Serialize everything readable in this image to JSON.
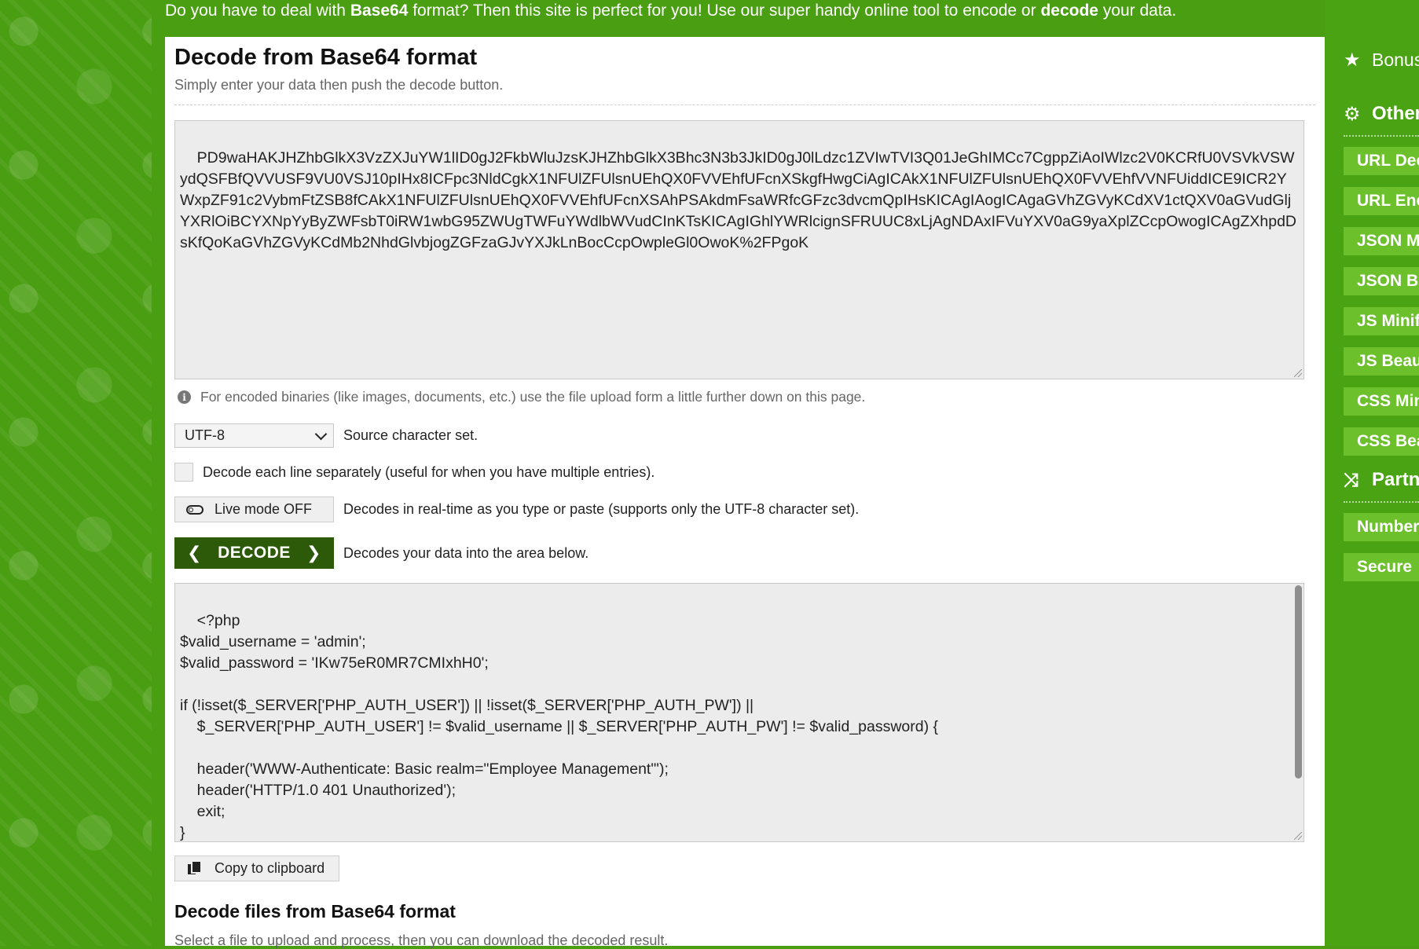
{
  "banner": {
    "part1": "Do you have to deal with ",
    "bold1": "Base64",
    "part2": " format? Then this site is perfect for you! Use our super handy online tool to encode or ",
    "bold2": "decode",
    "part3": " your data."
  },
  "main": {
    "title": "Decode from Base64 format",
    "subtitle": "Simply enter your data then push the decode button.",
    "input_value": "PD9waHAKJHZhbGlkX3VzZXJuYW1lID0gJ2FkbWluJzsKJHZhbGlkX3Bhc3N3b3JkID0gJ0lLdzc1ZVIwTVI3Q01JeGhIMCc7CgppZiAoIWlzc2V0KCRfU0VSVkVSWydQSFBfQVVUSF9VU0VSJ10pIHx8ICFpc3NldCgkX1NFUlZFUlsnUEhQX0FVVEhfUFcnXSkgfHwgCiAgICAkX1NFUlZFUlsnUEhQX0FVVEhfVVNFUiddICE9ICR2YWxpZF91c2VybmFtZSB8fCAkX1NFUlZFUlsnUEhQX0FVVEhfUFcnXSAhPSAkdmFsaWRfcGFzc3dvcmQpIHsKICAgIAogICAgaGVhZGVyKCdXV1ctQXV0aGVudGljYXRlOiBCYXNpYyByZWFsbT0iRW1wbG95ZWUgTWFuYWdlbWVudCInKTsKICAgIGhlYWRlcignSFRUUC8xLjAgNDAxIFVuYXV0aG9yaXplZCcpOwogICAgZXhpdDsKfQoKaGVhZGVyKCdMb2NhdGlvbjogZGFzaGJvYXJkLnBocCcpOwpleGl0OwoK%2FPgoK",
    "info_text": "For encoded binaries (like images, documents, etc.) use the file upload form a little further down on this page.",
    "charset_value": "UTF-8",
    "charset_label": "Source character set.",
    "each_line_label": "Decode each line separately (useful for when you have multiple entries).",
    "live_mode_label": "Live mode OFF",
    "live_mode_desc": "Decodes in real-time as you type or paste (supports only the UTF-8 character set).",
    "decode_label": "DECODE",
    "decode_desc": "Decodes your data into the area below.",
    "output_value": "<?php\n$valid_username = 'admin';\n$valid_password = 'IKw75eR0MR7CMIxhH0';\n\nif (!isset($_SERVER['PHP_AUTH_USER']) || !isset($_SERVER['PHP_AUTH_PW']) ||\n    $_SERVER['PHP_AUTH_USER'] != $valid_username || $_SERVER['PHP_AUTH_PW'] != $valid_password) {\n\n    header('WWW-Authenticate: Basic realm=\"Employee Management\"');\n    header('HTTP/1.0 401 Unauthorized');\n    exit;\n}",
    "copy_label": "Copy to clipboard",
    "files_title": "Decode files from Base64 format",
    "files_subtitle": "Select a file to upload and process, then you can download the decoded result."
  },
  "sidebar": {
    "bonus": "Bonus",
    "other": "Other",
    "items": [
      "URL Decode",
      "URL Encode",
      "JSON Minify",
      "JSON Beautify",
      "JS Minify",
      "JS Beautify",
      "CSS Minify",
      "CSS Beautify"
    ],
    "partners": "Partners",
    "partner_items": [
      "Number",
      "Secure"
    ]
  },
  "colors": {
    "background": "#4a9e12",
    "decode_button": "#2c5a08",
    "sidebar_item": "#6cc02b"
  }
}
